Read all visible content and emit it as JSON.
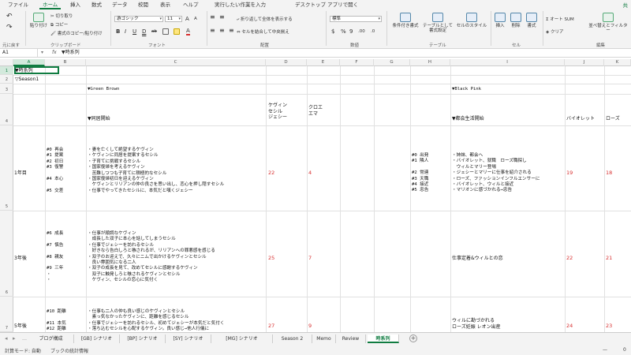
{
  "menu": {
    "tabs": [
      "ファイル",
      "ホーム",
      "挿入",
      "数式",
      "データ",
      "校閲",
      "表示",
      "ヘルプ"
    ],
    "search": "実行したい作業を入力",
    "open_desktop": "デスクトップ アプリで開く",
    "share": "共"
  },
  "ribbon": {
    "undo_label": "元に戻す",
    "clipboard": {
      "label": "クリップボード",
      "paste": "貼り付け",
      "cut": "切り取り",
      "copy": "コピー",
      "format_painter": "書式のコピー/貼り付け"
    },
    "font": {
      "label": "フォント",
      "name": "游ゴシック",
      "size": "11",
      "grow": "A",
      "shrink": "A",
      "bold": "B",
      "italic": "I",
      "underline": "U",
      "double_underline": "D",
      "strike": "ab"
    },
    "alignment": {
      "label": "配置",
      "wrap": "折り返して全体を表示する",
      "merge": "セルを結合して中央揃え"
    },
    "number": {
      "label": "数値",
      "format": "標準",
      "currency": "$",
      "percent": "%",
      "comma": "9",
      "inc_decimal": ".00",
      "dec_decimal": ".0"
    },
    "styles": {
      "label": "テーブル",
      "conditional": "条件付き書式",
      "as_table": "テーブルとして書式設定",
      "cell_styles": "セルのスタイル"
    },
    "cells": {
      "label": "セル",
      "insert": "挿入",
      "delete": "削除",
      "format": "書式"
    },
    "editing": {
      "label": "編集",
      "autosum": "オート SUM",
      "clear": "クリア",
      "sort_filter": "並べ替えとフィルター"
    }
  },
  "formula_bar": {
    "name_box": "A1",
    "fx": "fx",
    "formula": "▼時系列"
  },
  "columns": [
    "A",
    "B",
    "C",
    "D",
    "E",
    "F",
    "G",
    "H",
    "I",
    "J",
    "K"
  ],
  "rows": [
    "1",
    "2",
    "3",
    "4",
    "5",
    "6",
    "7"
  ],
  "cells": {
    "a1": "▼時系列",
    "a2": "▽Season1",
    "c3": "▼Green Brown",
    "i3": "▼Black Pink",
    "c4": "▼同居開始",
    "d4": "ケヴィン\nセシル\nジェシー",
    "e4": "クロエ\nエマ",
    "i4": "▼都会生活開始",
    "j4": "バイオレット",
    "k4": "ローズ",
    "a5": "1年目",
    "b5": "#0 再会\n#1 提案\n#2 初日\n#3 復讐\n\n#4 本心\n\n#5 交差",
    "c5": "・妻を亡くして絶望するケヴィン\n・ケヴィンに同居を提案するセシル\n・子育てに挑戦するセシル\n・国家復帰を考えるケヴィン\n　苦難しつつも子育てに積極的なセシル\n・国家復帰初日を迎えるケヴィン\n　ケヴィンとリリアンの仲の良さを思い出し、恋心を押し隠すセシル\n・仕事でやってきたセシルに、本気だと嘆くジェシー",
    "d5": "22",
    "e5": "4",
    "h5": "#0 出発\n#1 隣人\n\n#2 常連\n#3 天職\n#4 接近\n#5 忠告",
    "i5": "・姉妹、都会へ\n・バイオレット、就職　ローズ職探し\n　ウィルとマリー登場\n・ジェシーとマリーに仕事を紹介される\n・ローズ、ファッションインフルエンサーに\n・バイオレット、ウィルと接近\n・マリオンに感づかれる→忠告",
    "j5": "19",
    "k5": "18",
    "a6": "3年後",
    "b6": "#6 成長\n\n#7 慎告\n\n#8 親友\n\n#9 三年\n・\n・",
    "c6": "・仕事が順調なケヴィン\n　成長した双子に本心を話してしまうセシル\n・仕事でジェシーを訪れるセシル\n　好きなら告白しろと嗾されるが、リリアンへの罪悪感を感じる\n・双子のお迎えで、久々にニムで出かけるケヴィンとセシル\n　良い雰囲気になる二人\n・双子の成長を見て、改めてセシルに感謝するケヴィン\n　双子に触発しろと嗾されるケヴィンとセシル\n　ケヴィン、セシルの恋心に気付く",
    "d6": "25",
    "e6": "7",
    "i6": "仕事定着&ウィルとの恋",
    "j6": "22",
    "k6": "21",
    "a7": "5年後",
    "b7": "#10 距離\n\n#11 本気\n#12 距離",
    "c7": "・仕事も二人の仲も良い感じのケヴィンとセシル\n　素っ気なかったケヴィンに、距離を感じるセシル\n・仕事でジェシーを訪れるセシル、初めてジェシーが本気だと気付く\n・落ち込むセシルを心配するケヴィン。良い感じ→他人行儀に",
    "d7": "27",
    "e7": "9",
    "i7": "ウィルに勘づかれる\nローズ妊娠 レオン出産",
    "j7": "24",
    "k7": "23"
  },
  "sheets": [
    "ブログ構成",
    "[GB] シナリオ",
    "[BP] シナリオ",
    "[SY] シナリオ",
    "[MG] シナリオ",
    "Season 2",
    "Memo",
    "Review",
    "時系列"
  ],
  "active_sheet": "時系列",
  "status": {
    "calc_mode": "計算モード: 自動",
    "workbook_stats": "ブックの統計情報",
    "zoom_minus": "—",
    "zoom_value": "0"
  },
  "colors": {
    "accent": "#107c41",
    "red_value": "#d83030"
  }
}
